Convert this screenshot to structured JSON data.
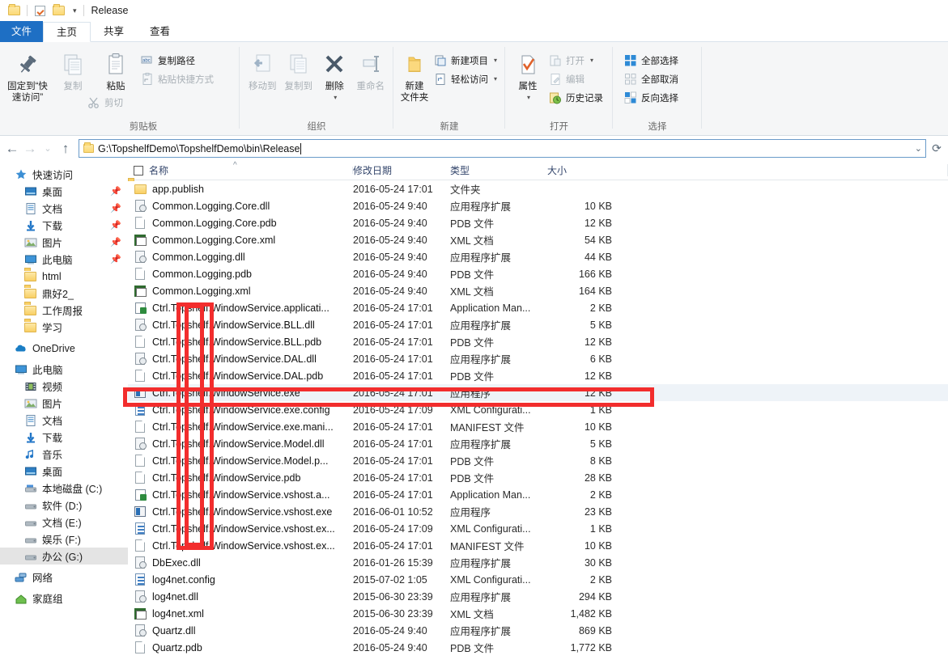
{
  "window": {
    "title": "Release",
    "quick_access": [
      "folder-icon",
      "separator",
      "properties-check-icon",
      "folder-new-icon",
      "dropdown-caret"
    ]
  },
  "tabs": [
    {
      "label": "文件",
      "name": "tab-file",
      "state": "file-menu"
    },
    {
      "label": "主页",
      "name": "tab-home",
      "state": "active"
    },
    {
      "label": "共享",
      "name": "tab-share",
      "state": "normal"
    },
    {
      "label": "查看",
      "name": "tab-view",
      "state": "normal"
    }
  ],
  "ribbon": {
    "groups": [
      {
        "name": "clipboard",
        "label": "剪贴板",
        "big_buttons": [
          {
            "label": "固定到“快\n速访问”",
            "icon": "pin-icon",
            "dim": false
          },
          {
            "label": "复制",
            "icon": "copy-icon",
            "dim": true
          },
          {
            "label": "粘贴",
            "icon": "paste-icon",
            "dim": false
          }
        ],
        "small_buttons": [
          {
            "label": "复制路径",
            "icon": "copy-path-icon",
            "dim": false
          },
          {
            "label": "粘贴快捷方式",
            "icon": "paste-shortcut-icon",
            "dim": true
          }
        ],
        "extra_small": [
          {
            "label": "剪切",
            "icon": "scissors-icon",
            "dim": true
          }
        ]
      },
      {
        "name": "organize",
        "label": "组织",
        "big_buttons": [
          {
            "label": "移动到",
            "icon": "move-to-icon",
            "dim": true
          },
          {
            "label": "复制到",
            "icon": "copy-to-icon",
            "dim": true
          },
          {
            "label": "删除",
            "icon": "delete-x-icon",
            "dim": false
          },
          {
            "label": "重命名",
            "icon": "rename-icon",
            "dim": true
          }
        ]
      },
      {
        "name": "new",
        "label": "新建",
        "big_buttons": [
          {
            "label": "新建\n文件夹",
            "icon": "new-folder-icon",
            "dim": false
          }
        ],
        "small_buttons": [
          {
            "label": "新建项目",
            "icon": "new-item-icon",
            "dim": false,
            "caret": true
          },
          {
            "label": "轻松访问",
            "icon": "easy-access-icon",
            "dim": false,
            "caret": true
          }
        ]
      },
      {
        "name": "open",
        "label": "打开",
        "big_buttons": [
          {
            "label": "属性",
            "icon": "properties-icon",
            "dim": false,
            "caret": true
          }
        ],
        "small_buttons": [
          {
            "label": "打开",
            "icon": "open-icon",
            "dim": true,
            "caret": true
          },
          {
            "label": "编辑",
            "icon": "edit-icon",
            "dim": true
          },
          {
            "label": "历史记录",
            "icon": "history-icon",
            "dim": false
          }
        ]
      },
      {
        "name": "select",
        "label": "选择",
        "small_buttons": [
          {
            "label": "全部选择",
            "icon": "select-all-icon",
            "dim": false
          },
          {
            "label": "全部取消",
            "icon": "select-none-icon",
            "dim": false
          },
          {
            "label": "反向选择",
            "icon": "invert-selection-icon",
            "dim": false
          }
        ]
      }
    ]
  },
  "address_bar": {
    "back_icon": "arrow-left-icon",
    "forward_icon": "arrow-right-icon",
    "recent_icon": "chevron-down-icon",
    "up_icon": "arrow-up-icon",
    "path": "G:\\TopshelfDemo\\TopshelfDemo\\bin\\Release",
    "dropdown_icon": "chevron-down-icon",
    "refresh_icon": "refresh-icon"
  },
  "nav_pane": {
    "sections": [
      {
        "header": {
          "label": "快速访问",
          "icon": "star-icon"
        },
        "items": [
          {
            "label": "桌面",
            "icon": "desktop-icon",
            "pinned": true
          },
          {
            "label": "文档",
            "icon": "documents-icon",
            "pinned": true
          },
          {
            "label": "下载",
            "icon": "downloads-icon",
            "pinned": true
          },
          {
            "label": "图片",
            "icon": "pictures-icon",
            "pinned": true
          },
          {
            "label": "此电脑",
            "icon": "this-pc-icon",
            "pinned": true
          },
          {
            "label": "html",
            "icon": "folder-icon",
            "pinned": false
          },
          {
            "label": "鼎好2_",
            "icon": "folder-icon",
            "pinned": false
          },
          {
            "label": "工作周报",
            "icon": "folder-icon",
            "pinned": false
          },
          {
            "label": "学习",
            "icon": "folder-icon",
            "pinned": false
          }
        ]
      },
      {
        "header": {
          "label": "OneDrive",
          "icon": "onedrive-icon"
        },
        "items": []
      },
      {
        "header": {
          "label": "此电脑",
          "icon": "this-pc-icon"
        },
        "items": [
          {
            "label": "视频",
            "icon": "videos-icon",
            "pinned": false
          },
          {
            "label": "图片",
            "icon": "pictures-icon",
            "pinned": false
          },
          {
            "label": "文档",
            "icon": "documents-icon",
            "pinned": false
          },
          {
            "label": "下载",
            "icon": "downloads-icon",
            "pinned": false
          },
          {
            "label": "音乐",
            "icon": "music-icon",
            "pinned": false
          },
          {
            "label": "桌面",
            "icon": "desktop-icon",
            "pinned": false
          },
          {
            "label": "本地磁盘 (C:)",
            "icon": "drive-system-icon",
            "pinned": false
          },
          {
            "label": "软件 (D:)",
            "icon": "drive-icon",
            "pinned": false
          },
          {
            "label": "文档 (E:)",
            "icon": "drive-icon",
            "pinned": false
          },
          {
            "label": "娱乐 (F:)",
            "icon": "drive-icon",
            "pinned": false
          },
          {
            "label": "办公 (G:)",
            "icon": "drive-icon",
            "pinned": false,
            "selected": true
          }
        ]
      },
      {
        "header": {
          "label": "网络",
          "icon": "network-icon"
        },
        "items": []
      },
      {
        "header": {
          "label": "家庭组",
          "icon": "homegroup-icon"
        },
        "items": []
      }
    ]
  },
  "file_list": {
    "columns": [
      {
        "key": "name",
        "label": "名称"
      },
      {
        "key": "date",
        "label": "修改日期"
      },
      {
        "key": "type",
        "label": "类型"
      },
      {
        "key": "size",
        "label": "大小"
      }
    ],
    "sort": {
      "column": "名称",
      "direction": "asc",
      "marker": "^"
    },
    "rows": [
      {
        "name": "app.publish",
        "date": "2016-05-24 17:01",
        "type": "文件夹",
        "size": "",
        "icon": "folder-icon"
      },
      {
        "name": "Common.Logging.Core.dll",
        "date": "2016-05-24 9:40",
        "type": "应用程序扩展",
        "size": "10 KB",
        "icon": "dll-icon"
      },
      {
        "name": "Common.Logging.Core.pdb",
        "date": "2016-05-24 9:40",
        "type": "PDB 文件",
        "size": "12 KB",
        "icon": "page-icon"
      },
      {
        "name": "Common.Logging.Core.xml",
        "date": "2016-05-24 9:40",
        "type": "XML 文档",
        "size": "54 KB",
        "icon": "xml-icon"
      },
      {
        "name": "Common.Logging.dll",
        "date": "2016-05-24 9:40",
        "type": "应用程序扩展",
        "size": "44 KB",
        "icon": "dll-icon"
      },
      {
        "name": "Common.Logging.pdb",
        "date": "2016-05-24 9:40",
        "type": "PDB 文件",
        "size": "166 KB",
        "icon": "page-icon"
      },
      {
        "name": "Common.Logging.xml",
        "date": "2016-05-24 9:40",
        "type": "XML 文档",
        "size": "164 KB",
        "icon": "xml-icon"
      },
      {
        "name": "Ctrl.Topshelf.WindowService.applicati...",
        "date": "2016-05-24 17:01",
        "type": "Application Man...",
        "size": "2 KB",
        "icon": "appman-icon"
      },
      {
        "name": "Ctrl.Topshelf.WindowService.BLL.dll",
        "date": "2016-05-24 17:01",
        "type": "应用程序扩展",
        "size": "5 KB",
        "icon": "dll-icon"
      },
      {
        "name": "Ctrl.Topshelf.WindowService.BLL.pdb",
        "date": "2016-05-24 17:01",
        "type": "PDB 文件",
        "size": "12 KB",
        "icon": "page-icon"
      },
      {
        "name": "Ctrl.Topshelf.WindowService.DAL.dll",
        "date": "2016-05-24 17:01",
        "type": "应用程序扩展",
        "size": "6 KB",
        "icon": "dll-icon"
      },
      {
        "name": "Ctrl.Topshelf.WindowService.DAL.pdb",
        "date": "2016-05-24 17:01",
        "type": "PDB 文件",
        "size": "12 KB",
        "icon": "page-icon"
      },
      {
        "name": "Ctrl.Topshelf.WindowService.exe",
        "date": "2016-05-24 17:01",
        "type": "应用程序",
        "size": "12 KB",
        "icon": "exe-icon",
        "highlighted": true
      },
      {
        "name": "Ctrl.Topshelf.WindowService.exe.config",
        "date": "2016-05-24 17:09",
        "type": "XML Configurati...",
        "size": "1 KB",
        "icon": "config-icon"
      },
      {
        "name": "Ctrl.Topshelf.WindowService.exe.mani...",
        "date": "2016-05-24 17:01",
        "type": "MANIFEST 文件",
        "size": "10 KB",
        "icon": "page-icon"
      },
      {
        "name": "Ctrl.Topshelf.WindowService.Model.dll",
        "date": "2016-05-24 17:01",
        "type": "应用程序扩展",
        "size": "5 KB",
        "icon": "dll-icon"
      },
      {
        "name": "Ctrl.Topshelf.WindowService.Model.p...",
        "date": "2016-05-24 17:01",
        "type": "PDB 文件",
        "size": "8 KB",
        "icon": "page-icon"
      },
      {
        "name": "Ctrl.Topshelf.WindowService.pdb",
        "date": "2016-05-24 17:01",
        "type": "PDB 文件",
        "size": "28 KB",
        "icon": "page-icon"
      },
      {
        "name": "Ctrl.Topshelf.WindowService.vshost.a...",
        "date": "2016-05-24 17:01",
        "type": "Application Man...",
        "size": "2 KB",
        "icon": "appman-icon"
      },
      {
        "name": "Ctrl.Topshelf.WindowService.vshost.exe",
        "date": "2016-06-01 10:52",
        "type": "应用程序",
        "size": "23 KB",
        "icon": "exe-icon"
      },
      {
        "name": "Ctrl.Topshelf.WindowService.vshost.ex...",
        "date": "2016-05-24 17:09",
        "type": "XML Configurati...",
        "size": "1 KB",
        "icon": "config-icon"
      },
      {
        "name": "Ctrl.Topshelf.WindowService.vshost.ex...",
        "date": "2016-05-24 17:01",
        "type": "MANIFEST 文件",
        "size": "10 KB",
        "icon": "page-icon"
      },
      {
        "name": "DbExec.dll",
        "date": "2016-01-26 15:39",
        "type": "应用程序扩展",
        "size": "30 KB",
        "icon": "dll-icon"
      },
      {
        "name": "log4net.config",
        "date": "2015-07-02 1:05",
        "type": "XML Configurati...",
        "size": "2 KB",
        "icon": "config-icon"
      },
      {
        "name": "log4net.dll",
        "date": "2015-06-30 23:39",
        "type": "应用程序扩展",
        "size": "294 KB",
        "icon": "dll-icon"
      },
      {
        "name": "log4net.xml",
        "date": "2015-06-30 23:39",
        "type": "XML 文档",
        "size": "1,482 KB",
        "icon": "xml-icon"
      },
      {
        "name": "Quartz.dll",
        "date": "2016-05-24 9:40",
        "type": "应用程序扩展",
        "size": "869 KB",
        "icon": "dll-icon"
      },
      {
        "name": "Quartz.pdb",
        "date": "2016-05-24 9:40",
        "type": "PDB 文件",
        "size": "1,772 KB",
        "icon": "page-icon"
      }
    ]
  },
  "annotations": {
    "color": "#f22d2d",
    "shapes": [
      {
        "name": "vertical-outer-box",
        "note": "tall red rectangle over file-name prefix column"
      },
      {
        "name": "vertical-inner-box",
        "note": "inner tall red rectangle"
      },
      {
        "name": "horizontal-box",
        "note": "red rectangle around Ctrl.Topshelf.WindowService.exe row"
      }
    ]
  }
}
